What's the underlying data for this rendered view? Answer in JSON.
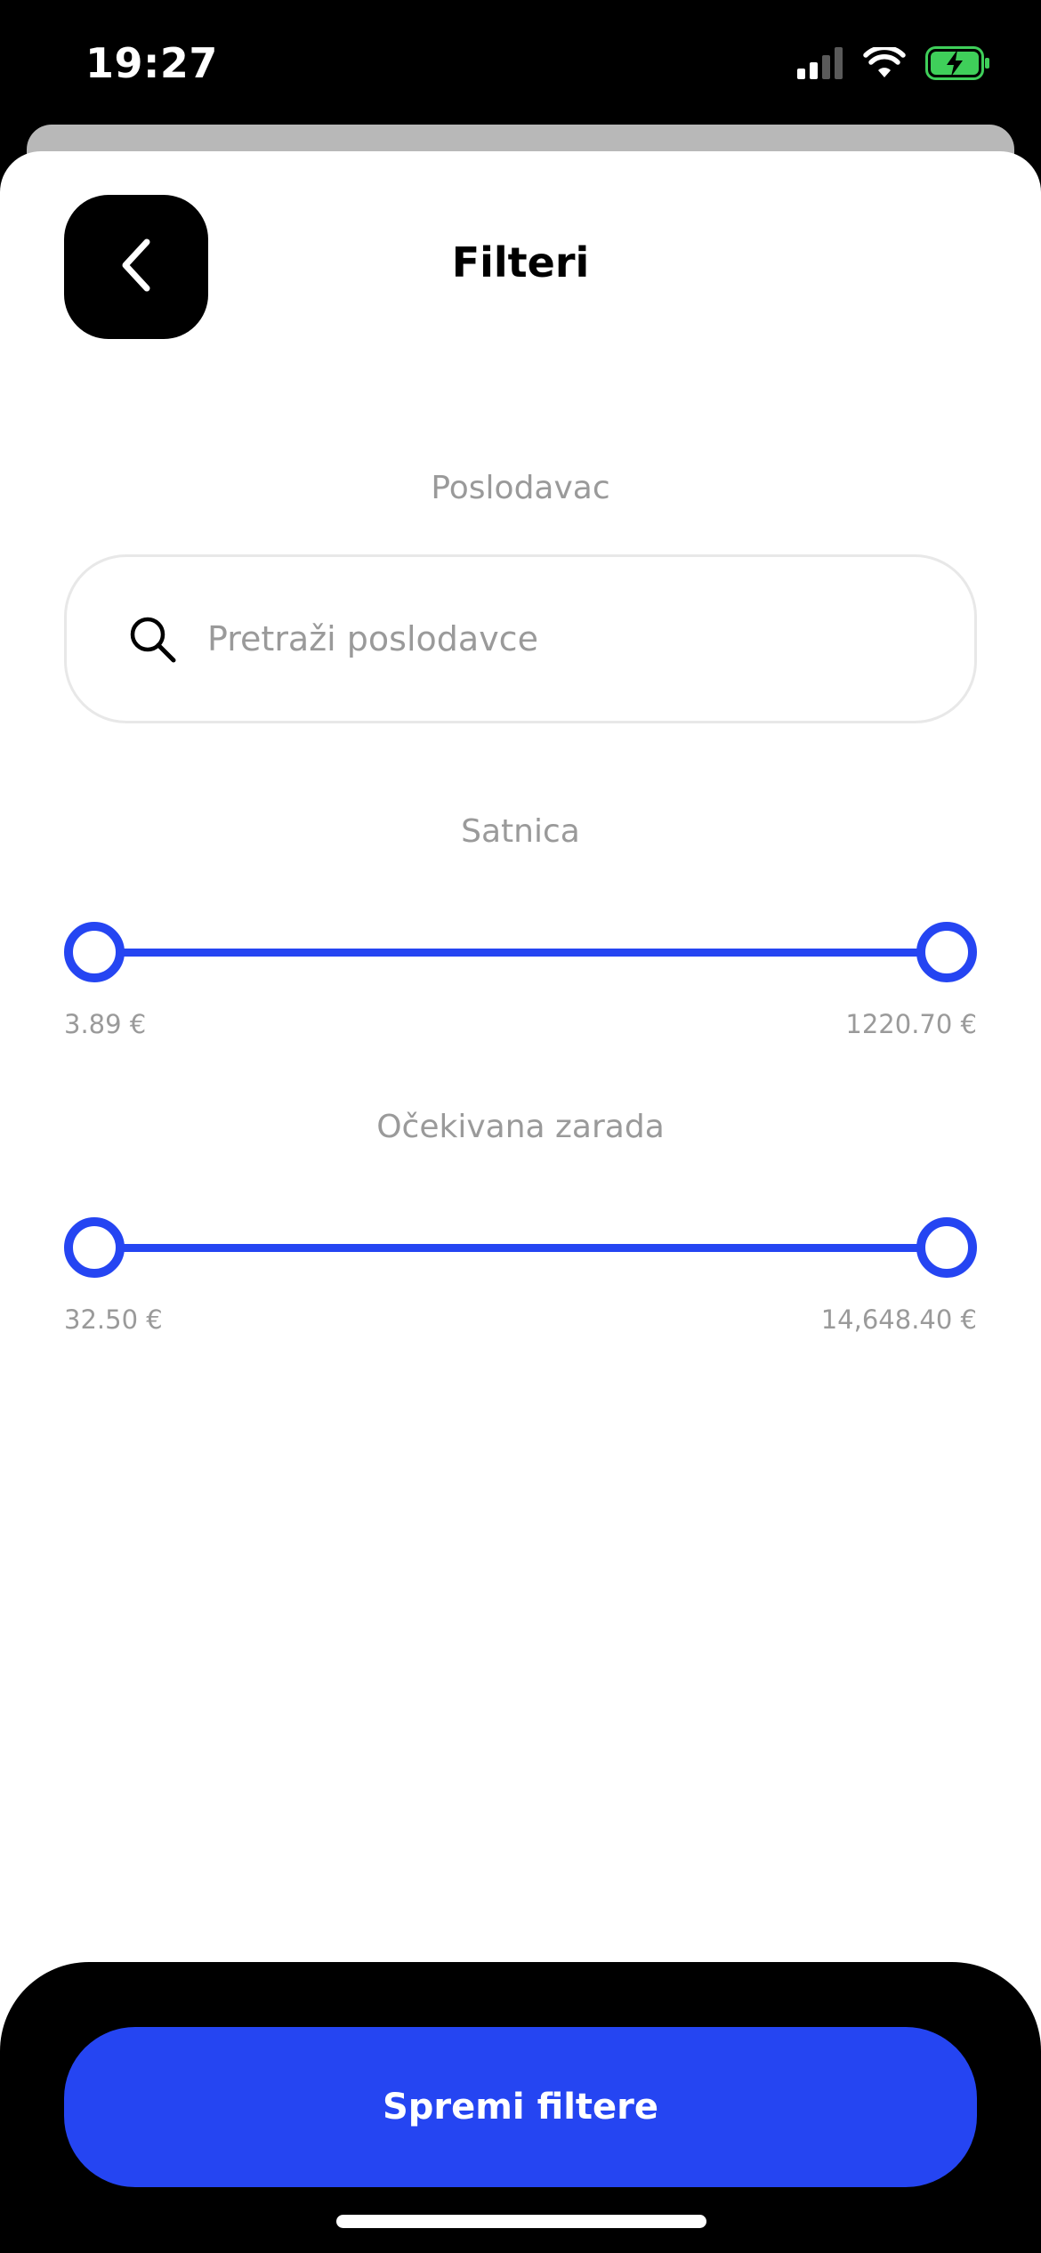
{
  "status_bar": {
    "time": "19:27",
    "icons": [
      "signal-icon",
      "wifi-icon",
      "battery-charging-icon"
    ],
    "battery_color": "#3fcf5a"
  },
  "header": {
    "title": "Filteri",
    "back_icon": "chevron-left-icon"
  },
  "employer": {
    "label": "Poslodavac",
    "search_placeholder": "Pretraži poslodavce",
    "search_value": "",
    "icon": "search-icon"
  },
  "hourly_rate": {
    "label": "Satnica",
    "min_label": "3.89 €",
    "max_label": "1220.70 €",
    "selected_min_fraction": 0,
    "selected_max_fraction": 1
  },
  "expected_earnings": {
    "label": "Očekivana zarada",
    "min_label": "32.50 €",
    "max_label": "14,648.40 €",
    "selected_min_fraction": 0,
    "selected_max_fraction": 1
  },
  "footer": {
    "save_label": "Spremi filtere"
  },
  "colors": {
    "accent": "#2545f2",
    "muted_text": "#9a9a9a",
    "dark": "#000000"
  }
}
